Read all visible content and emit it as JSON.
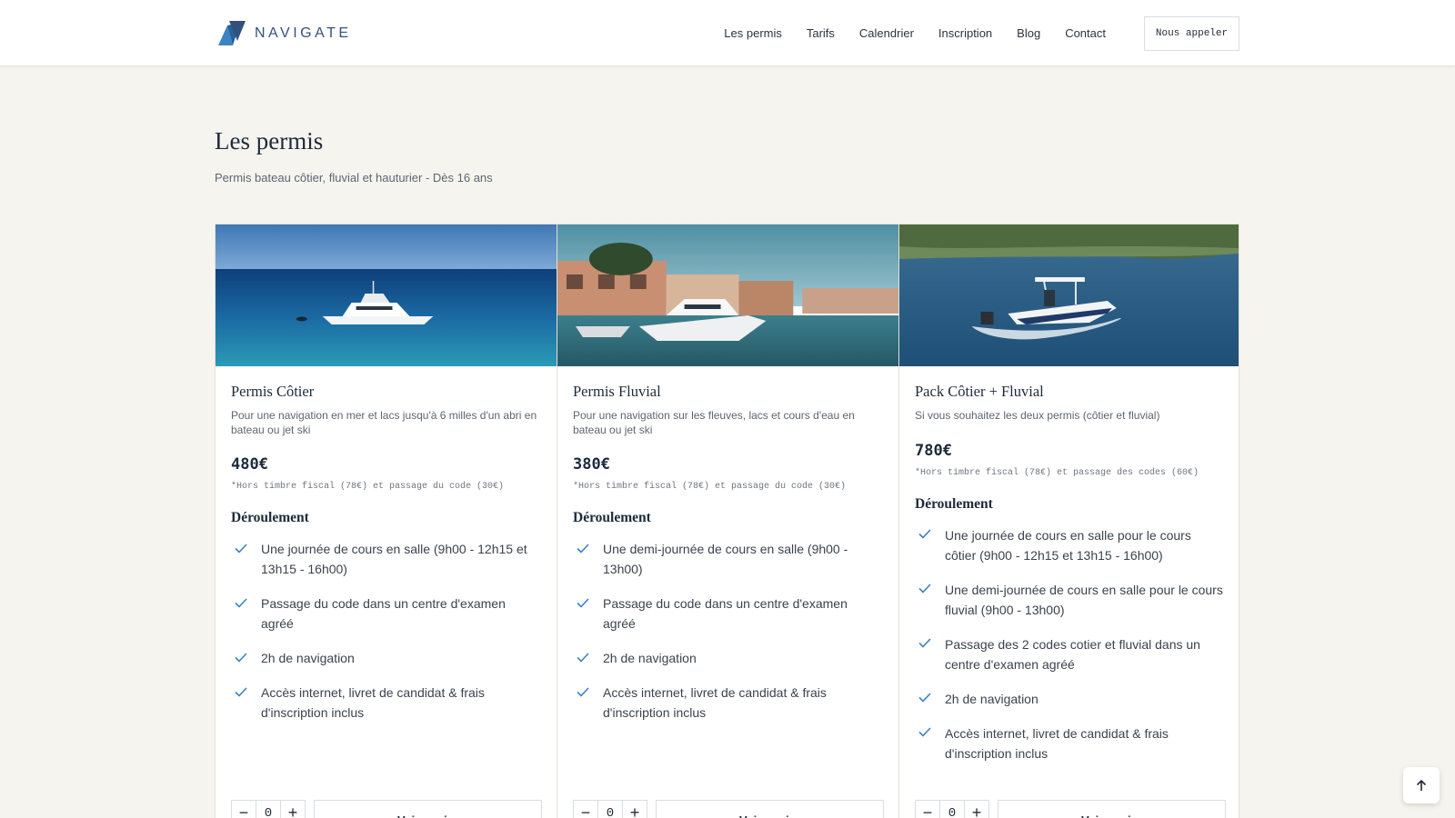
{
  "header": {
    "logo_text": "NAVIGATE",
    "nav": [
      "Les permis",
      "Tarifs",
      "Calendrier",
      "Inscription",
      "Blog",
      "Contact"
    ],
    "call_button": "Nous appeler"
  },
  "section": {
    "title": "Les permis",
    "subtitle": "Permis bateau côtier, fluvial et hauturier - Dès 16 ans"
  },
  "cards": [
    {
      "title": "Permis Côtier",
      "description": "Pour une navigation en mer et lacs jusqu'à 6 milles d'un abri en bateau ou jet ski",
      "price": "480€",
      "price_note": "*Hors timbre fiscal (78€) et passage du code (30€)",
      "steps_title": "Déroulement",
      "steps": [
        "Une journée de cours en salle (9h00 - 12h15 et 13h15 - 16h00)",
        "Passage du code dans un centre d'examen agréé",
        "2h de navigation",
        "Accès internet, livret de candidat & frais d'inscription inclus"
      ],
      "quantity": "0",
      "cart_label": "Voir panier"
    },
    {
      "title": "Permis Fluvial",
      "description": "Pour une navigation sur les fleuves, lacs et cours d'eau en bateau ou jet ski",
      "price": "380€",
      "price_note": "*Hors timbre fiscal (78€) et passage du code (30€)",
      "steps_title": "Déroulement",
      "steps": [
        "Une demi-journée de cours en salle (9h00 - 13h00)",
        "Passage du code dans un centre d'examen agréé",
        "2h de navigation",
        "Accès internet, livret de candidat & frais d'inscription inclus"
      ],
      "quantity": "0",
      "cart_label": "Voir panier"
    },
    {
      "title": "Pack Côtier + Fluvial",
      "description": "Si vous souhaitez les deux permis (côtier et fluvial)",
      "price": "780€",
      "price_note": "*Hors timbre fiscal (78€) et passage des codes (60€)",
      "steps_title": "Déroulement",
      "steps": [
        "Une journée de cours en salle pour le cours côtier (9h00 - 12h15 et 13h15 - 16h00)",
        "Une demi-journée de cours en salle pour le cours fluvial (9h00 - 13h00)",
        "Passage des 2 codes cotier et fluvial dans un centre d'examen agréé",
        "2h de navigation",
        "Accès internet, livret de candidat & frais d'inscription inclus"
      ],
      "quantity": "0",
      "cart_label": "Voir panier"
    }
  ],
  "colors": {
    "background": "#f6f4ef",
    "accent": "#3a83c5",
    "text": "#1d2b3a"
  },
  "icons": [
    "logo-icon",
    "check-icon",
    "minus-icon",
    "plus-icon",
    "arrow-up-icon"
  ]
}
